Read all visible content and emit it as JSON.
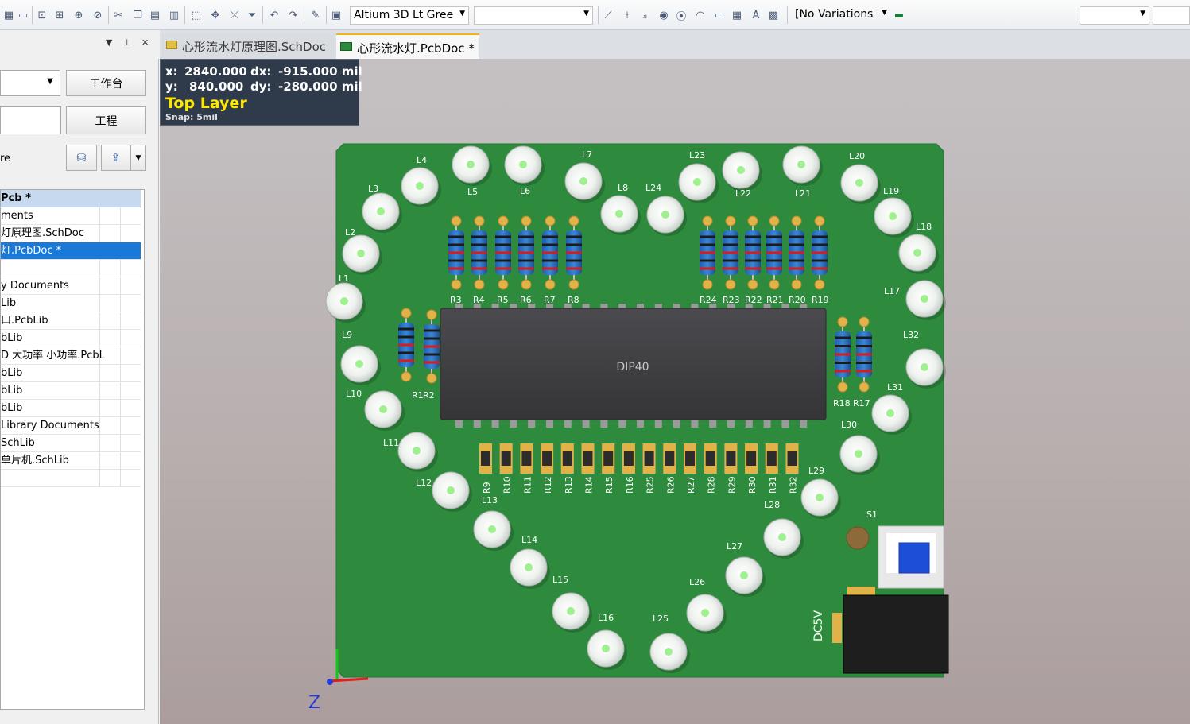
{
  "toolbar": {
    "view_config": "Altium 3D Lt Gree",
    "variations": "[No Variations"
  },
  "panel": {
    "btn_workspace": "工作台",
    "btn_project": "工程",
    "label_re": "re"
  },
  "tree": {
    "rows": [
      "Pcb *",
      "ments",
      "灯原理图.SchDoc",
      "灯.PcbDoc *",
      "",
      "y Documents",
      "Lib",
      "口.PcbLib",
      "bLib",
      "D 大功率 小功率.PcbL",
      "bLib",
      "bLib",
      "bLib",
      " Library Documents",
      "SchLib",
      "单片机.SchLib",
      ""
    ]
  },
  "tabs": [
    {
      "label": "心形流水灯原理图.SchDoc"
    },
    {
      "label": "心形流水灯.PcbDoc *"
    }
  ],
  "hud": {
    "x_label": "x:",
    "x_val": "2840.000",
    "dx_label": "dx:",
    "dx_val": "-915.000 mil",
    "y_label": "y:",
    "y_val": "840.000",
    "dy_label": "dy:",
    "dy_val": "-280.000 mil",
    "layer": "Top Layer",
    "snap": "Snap: 5mil"
  },
  "board": {
    "chip_label": "DIP40",
    "power_label": "DC5V",
    "switch_label": "S1",
    "leds": [
      "L1",
      "L2",
      "L3",
      "L4",
      "L5",
      "L6",
      "L7",
      "L8",
      "L9",
      "L10",
      "L11",
      "L12",
      "L13",
      "L14",
      "L15",
      "L16",
      "L17",
      "L18",
      "L19",
      "L20",
      "L21",
      "L22",
      "L23",
      "L24",
      "L25",
      "L26",
      "L27",
      "L28",
      "L29",
      "L30",
      "L31",
      "L32"
    ],
    "top_left_resistors": [
      "R3",
      "R4",
      "R5",
      "R6",
      "R7",
      "R8"
    ],
    "top_right_resistors": [
      "R24",
      "R23",
      "R22",
      "R21",
      "R20",
      "R19"
    ],
    "left_resistors": [
      "R1",
      "R2"
    ],
    "right_resistors": [
      "R18",
      "R17"
    ],
    "smd_resistors": [
      "R9",
      "R10",
      "R11",
      "R12",
      "R13",
      "R14",
      "R15",
      "R16",
      "R25",
      "R26",
      "R27",
      "R28",
      "R29",
      "R30",
      "R31",
      "R32"
    ],
    "axis_z": "Z"
  }
}
